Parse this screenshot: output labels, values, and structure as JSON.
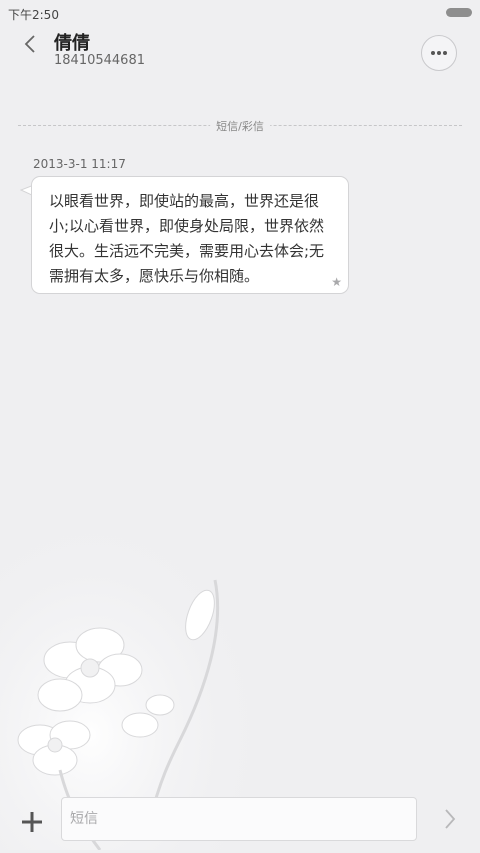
{
  "status_bar": {
    "time": "下午2:50"
  },
  "header": {
    "contact_name": "倩倩",
    "contact_number": "18410544681"
  },
  "divider": {
    "label": "短信/彩信"
  },
  "message": {
    "timestamp": "2013-3-1 11:17",
    "text": "以眼看世界，即使站的最高，世界还是很小;以心看世界，即使身处局限，世界依然很大。生活远不完美，需要用心去体会;无需拥有太多，愿快乐与你相随。"
  },
  "composer": {
    "placeholder": "短信",
    "value": ""
  },
  "icons": {
    "back": "chevron-left-icon",
    "more": "more-dots-icon",
    "star": "star-icon",
    "add": "plus-icon",
    "send": "chevron-right-icon"
  }
}
